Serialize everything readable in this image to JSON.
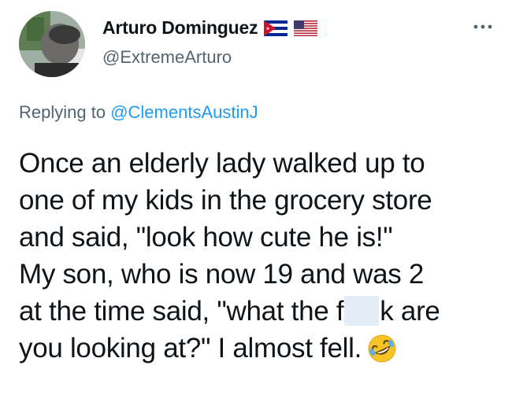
{
  "author": {
    "display_name": "Arturo Dominguez",
    "handle": "@ExtremeArturo",
    "flags": [
      "cuba-flag-icon",
      "usa-flag-icon"
    ]
  },
  "more_icon": "more-options-icon",
  "reply": {
    "prefix": "Replying to ",
    "mention": "@ClementsAustinJ"
  },
  "tweet": {
    "lines": [
      "Once an elderly lady walked up to",
      "one of my kids in the grocery store",
      "and said, \"look how cute he is!\"",
      "My son, who is now 19 and was 2",
      "at the time said, \"what the f",
      "you looking at?\" I almost fell."
    ],
    "line5_after_redaction": "k are",
    "emoji": "rolling-on-floor-laughing-emoji"
  },
  "colors": {
    "text": "#0f1419",
    "secondary": "#536471",
    "link": "#1d9bf0",
    "redaction": "#e3eef9"
  }
}
